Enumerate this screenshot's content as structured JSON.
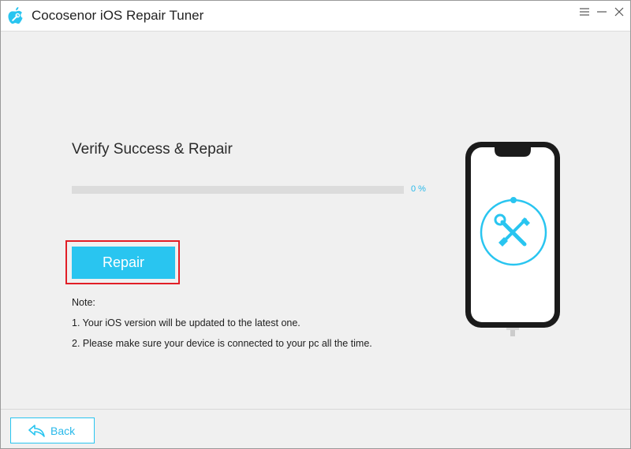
{
  "app": {
    "title": "Cocosenor iOS Repair Tuner",
    "logo_icon": "apple-wrench-logo-icon"
  },
  "window_controls": {
    "menu_icon": "menu-icon",
    "minimize_icon": "minimize-icon",
    "close_icon": "close-icon"
  },
  "main": {
    "heading": "Verify Success & Repair",
    "progress": {
      "value": 0,
      "label": "0 %"
    },
    "repair_button_label": "Repair",
    "note": {
      "title": "Note:",
      "lines": [
        "1. Your iOS version will be updated to the latest one.",
        "2. Please make sure your device is connected to your pc all the time."
      ]
    }
  },
  "illustration": {
    "device_icon": "iphone-icon",
    "tool_icon": "wrench-screwdriver-icon"
  },
  "footer": {
    "back_label": "Back",
    "back_icon": "back-arrow-icon"
  },
  "colors": {
    "accent": "#29c5f0",
    "accent_text": "#29b9ea",
    "highlight": "#e11e26",
    "background": "#f0f0f0",
    "track": "#dcdcdc"
  }
}
